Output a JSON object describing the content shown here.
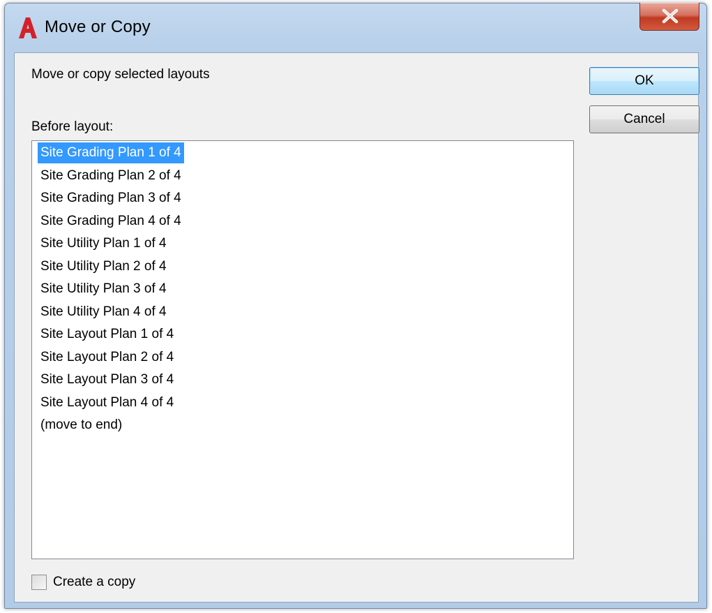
{
  "window": {
    "title": "Move or Copy"
  },
  "dialog": {
    "instruction": "Move or copy selected layouts",
    "list_label": "Before layout:",
    "layouts": [
      {
        "label": "Site Grading Plan 1 of 4",
        "selected": true
      },
      {
        "label": "Site Grading Plan 2 of 4",
        "selected": false
      },
      {
        "label": "Site Grading Plan 3 of 4",
        "selected": false
      },
      {
        "label": "Site Grading Plan 4 of 4",
        "selected": false
      },
      {
        "label": "Site Utility Plan 1 of 4",
        "selected": false
      },
      {
        "label": "Site Utility Plan 2 of 4",
        "selected": false
      },
      {
        "label": "Site Utility Plan 3 of 4",
        "selected": false
      },
      {
        "label": "Site Utility Plan 4 of 4",
        "selected": false
      },
      {
        "label": "Site Layout Plan 1 of 4",
        "selected": false
      },
      {
        "label": "Site Layout Plan 2 of 4",
        "selected": false
      },
      {
        "label": "Site Layout Plan 3 of 4",
        "selected": false
      },
      {
        "label": "Site Layout Plan 4 of 4",
        "selected": false
      },
      {
        "label": "(move to end)",
        "selected": false
      }
    ],
    "ok_label": "OK",
    "cancel_label": "Cancel",
    "create_copy_label": "Create a copy",
    "create_copy_checked": false
  },
  "icons": {
    "app": "autocad-logo-icon",
    "close": "close-icon"
  },
  "colors": {
    "selection": "#3399ff",
    "app_icon_red": "#d4202a",
    "close_button": "#c9442c"
  }
}
